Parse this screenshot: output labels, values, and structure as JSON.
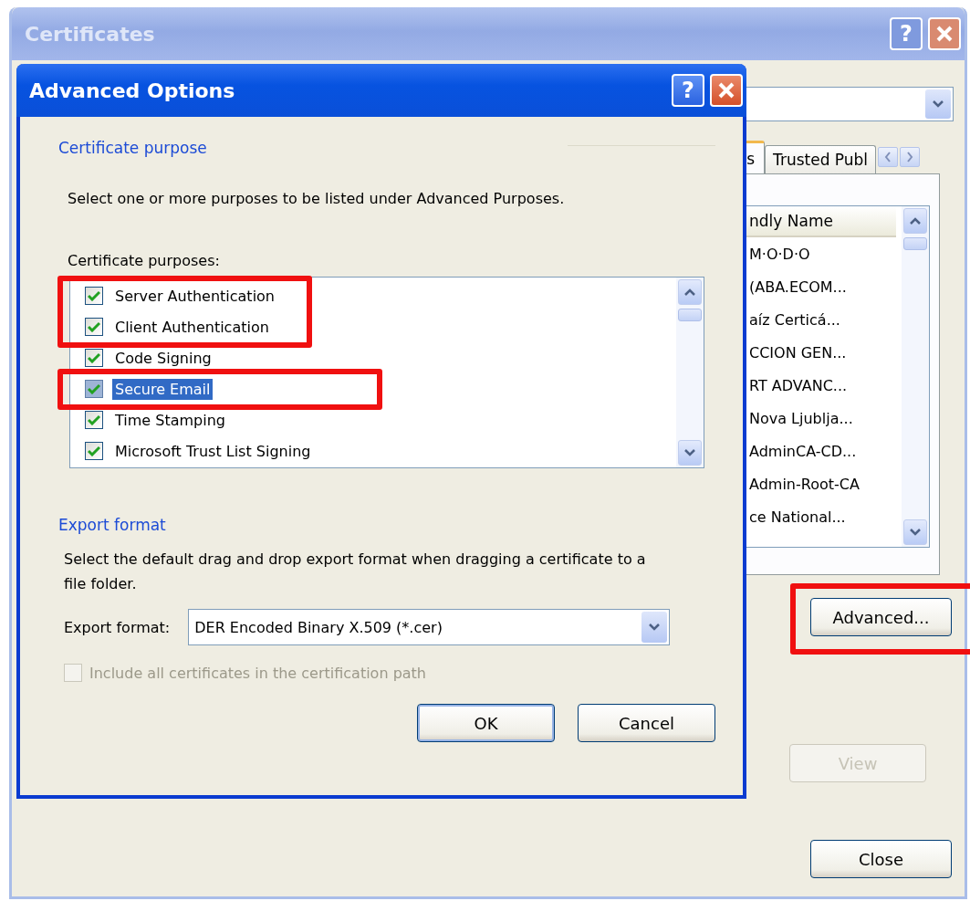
{
  "certificates_window": {
    "title": "Certificates",
    "help": "?",
    "tabs": [
      {
        "label": "s",
        "selected": true
      },
      {
        "label": "Trusted Publ",
        "selected": false
      }
    ],
    "list": {
      "column": "ndly Name",
      "rows": [
        "M·O·D·O",
        "(ABA.ECOM...",
        "aíz Certicá...",
        "CCION GEN...",
        "RT ADVANC...",
        "Nova Ljublja...",
        "AdminCA-CD...",
        "Admin-Root-CA",
        "ce National..."
      ]
    },
    "buttons": [
      {
        "label": "Advanced...",
        "disabled": false,
        "highlighted": true
      },
      {
        "label": "View",
        "disabled": true,
        "highlighted": false
      },
      {
        "label": "Close",
        "disabled": false,
        "highlighted": false
      }
    ]
  },
  "dialog": {
    "title": "Advanced Options",
    "help": "?",
    "purpose_group": {
      "title": "Certificate purpose",
      "description": "Select one or more purposes to be listed under Advanced Purposes.",
      "list_label": "Certificate purposes:",
      "purposes": [
        {
          "label": "Server Authentication",
          "checked": true,
          "selected": false,
          "highlighted": true
        },
        {
          "label": "Client Authentication",
          "checked": true,
          "selected": false,
          "highlighted": true
        },
        {
          "label": "Code Signing",
          "checked": true,
          "selected": false,
          "highlighted": false
        },
        {
          "label": "Secure Email",
          "checked": true,
          "selected": true,
          "highlighted": true
        },
        {
          "label": "Time Stamping",
          "checked": true,
          "selected": false,
          "highlighted": false
        },
        {
          "label": "Microsoft Trust List Signing",
          "checked": true,
          "selected": false,
          "highlighted": false
        }
      ]
    },
    "export_group": {
      "title": "Export format",
      "description": "Select the default drag and drop export format when dragging a certificate to a file folder.",
      "field_label": "Export format:",
      "value": "DER Encoded Binary X.509 (*.cer)",
      "include_path": {
        "label": "Include all certificates in the certification path",
        "checked": false,
        "disabled": true
      }
    },
    "buttons": [
      {
        "label": "OK",
        "default": true
      },
      {
        "label": "Cancel",
        "default": false
      }
    ]
  }
}
